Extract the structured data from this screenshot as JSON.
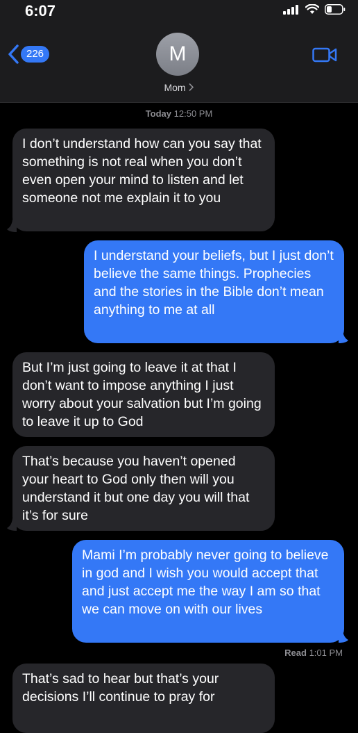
{
  "status_bar": {
    "time": "6:07"
  },
  "header": {
    "back_count": "226",
    "avatar_initial": "M",
    "contact_name": "Mom"
  },
  "timestamp": {
    "day": "Today",
    "time": "12:50 PM"
  },
  "messages": [
    {
      "from": "them",
      "text": "I don’t understand how can you say that something is not real when you don’t even open your mind to listen and let someone not me explain it to you"
    },
    {
      "from": "me",
      "text": "I understand your beliefs, but I just don’t believe the same things. Prophecies and the stories in the Bible don’t mean anything to me at all"
    },
    {
      "from": "them",
      "text": "But I’m just going to leave it at that I don’t want to impose anything I just worry about your salvation but I’m going to leave it up to God"
    },
    {
      "from": "them",
      "text": "That’s because you haven’t opened your heart to God only then will you understand it but one day you will that it’s for sure"
    },
    {
      "from": "me",
      "text": "Mami I’m probably never going to believe in god and I wish you would accept that and just accept me the way I am so that we can move on with our lives"
    },
    {
      "from": "them",
      "text": "That’s sad to hear but that’s your decisions I’ll continue to pray for"
    }
  ],
  "read_receipt": {
    "label": "Read",
    "time": "1:01 PM"
  },
  "colors": {
    "incoming": "#26262a",
    "outgoing": "#3478f6",
    "header": "#1c1c1e"
  }
}
